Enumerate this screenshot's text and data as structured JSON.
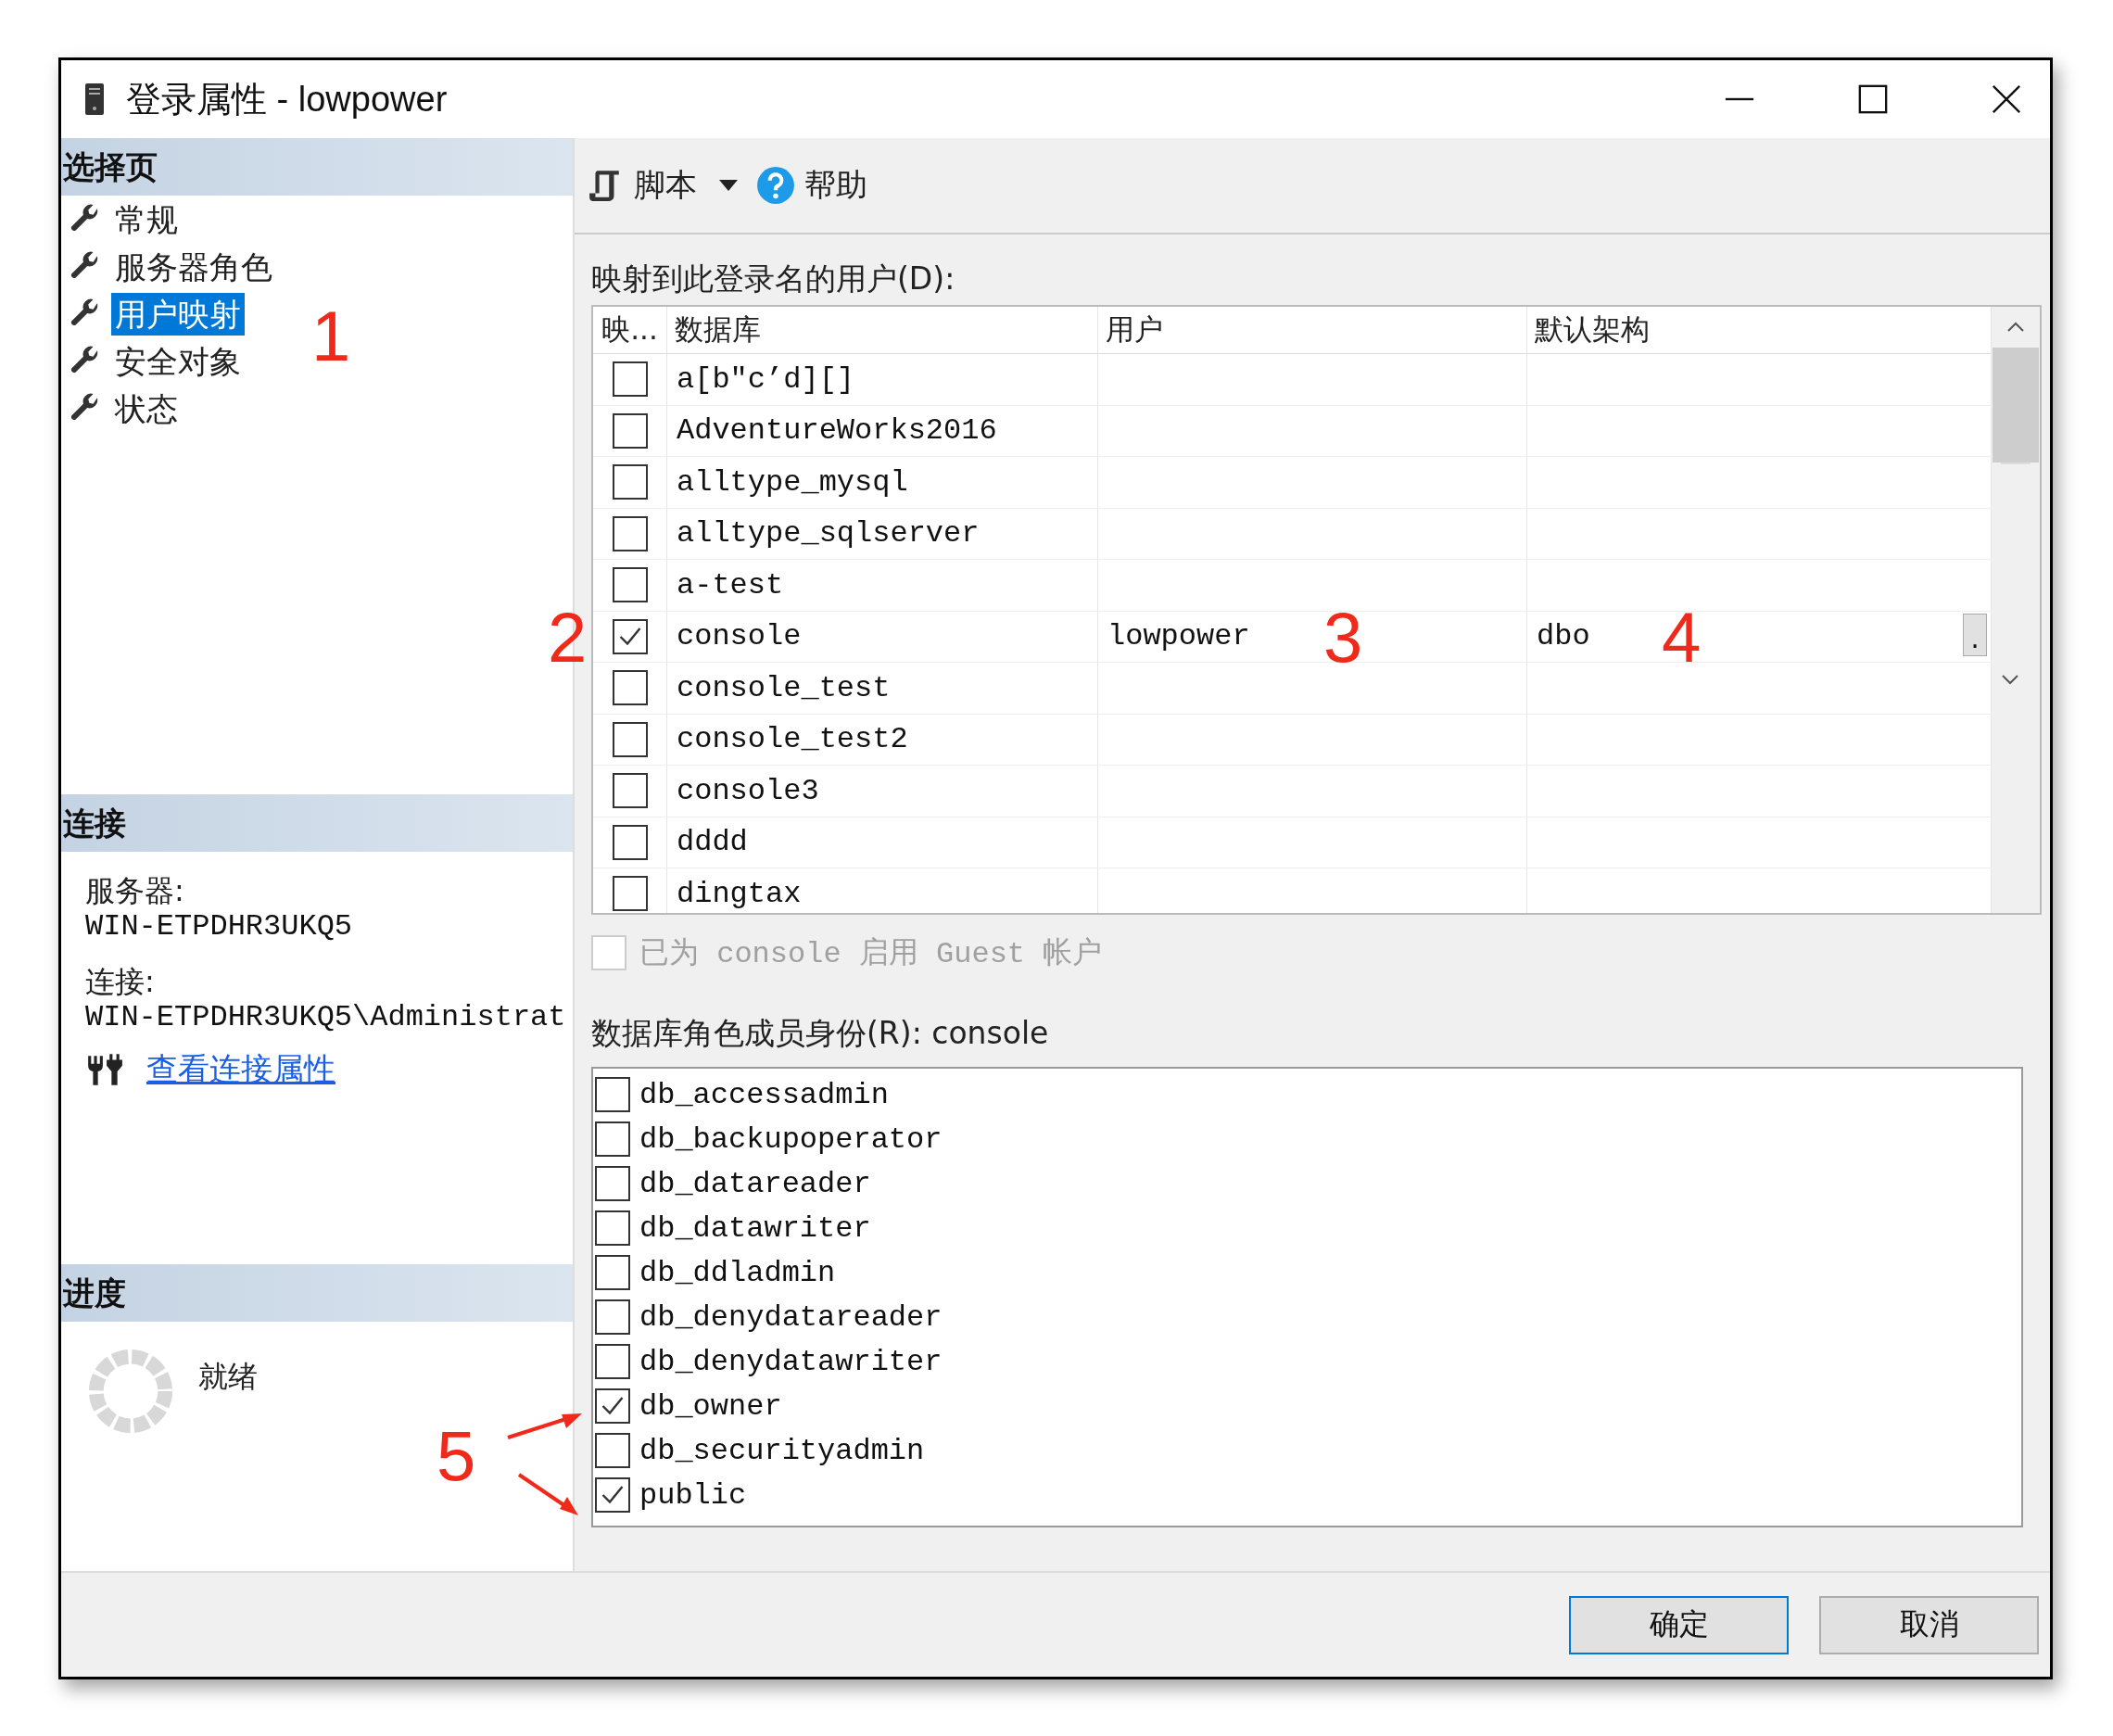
{
  "window": {
    "title": "登录属性 - lowpower"
  },
  "sidebar": {
    "header": "选择页",
    "items": [
      {
        "label": "常规",
        "selected": false
      },
      {
        "label": "服务器角色",
        "selected": false
      },
      {
        "label": "用户映射",
        "selected": true
      },
      {
        "label": "安全对象",
        "selected": false
      },
      {
        "label": "状态",
        "selected": false
      }
    ]
  },
  "connection": {
    "header": "连接",
    "server_label": "服务器:",
    "server": "WIN-ETPDHR3UKQ5",
    "connection_label": "连接:",
    "connection": "WIN-ETPDHR3UKQ5\\Administrat",
    "link": "查看连接属性"
  },
  "progress": {
    "header": "进度",
    "status": "就绪"
  },
  "toolbar": {
    "script": "脚本",
    "help": "帮助"
  },
  "users_label": "映射到此登录名的用户(D):",
  "users_table": {
    "columns": [
      "映...",
      "数据库",
      "用户",
      "默认架构"
    ],
    "rows": [
      {
        "checked": false,
        "database": "a[b″c’d][]"
      },
      {
        "checked": false,
        "database": "AdventureWorks2016"
      },
      {
        "checked": false,
        "database": "alltype_mysql"
      },
      {
        "checked": false,
        "database": "alltype_sqlserver"
      },
      {
        "checked": false,
        "database": "a-test"
      },
      {
        "checked": true,
        "database": "console",
        "user": "lowpower",
        "schema": "dbo",
        "browse": "."
      },
      {
        "checked": false,
        "database": "console_test"
      },
      {
        "checked": false,
        "database": "console_test2"
      },
      {
        "checked": false,
        "database": "console3"
      },
      {
        "checked": false,
        "database": "dddd"
      },
      {
        "checked": false,
        "database": "dingtax"
      }
    ]
  },
  "guest": {
    "label": "已为 console 启用 Guest 帐户",
    "checked": false,
    "disabled": true
  },
  "roles_label": "数据库角色成员身份(R): console",
  "roles": [
    {
      "label": "db_accessadmin",
      "checked": false
    },
    {
      "label": "db_backupoperator",
      "checked": false
    },
    {
      "label": "db_datareader",
      "checked": false
    },
    {
      "label": "db_datawriter",
      "checked": false
    },
    {
      "label": "db_ddladmin",
      "checked": false
    },
    {
      "label": "db_denydatareader",
      "checked": false
    },
    {
      "label": "db_denydatawriter",
      "checked": false
    },
    {
      "label": "db_owner",
      "checked": true
    },
    {
      "label": "db_securityadmin",
      "checked": false
    },
    {
      "label": "public",
      "checked": true
    }
  ],
  "buttons": [
    {
      "label": "确定",
      "default": true
    },
    {
      "label": "取消",
      "default": false
    }
  ],
  "annotations": [
    {
      "text": "1"
    },
    {
      "text": "2"
    },
    {
      "text": "3"
    },
    {
      "text": "4"
    },
    {
      "text": "5"
    }
  ]
}
